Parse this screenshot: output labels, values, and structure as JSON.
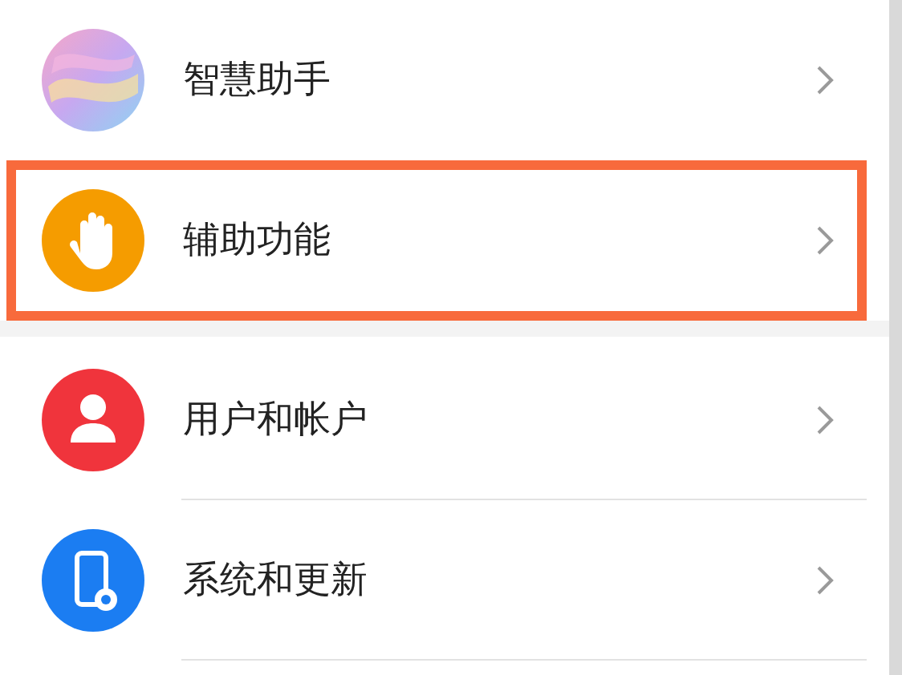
{
  "sections": [
    {
      "items": [
        {
          "label": "智慧助手",
          "kind": "orb",
          "highlighted": false
        },
        {
          "label": "辅助功能",
          "kind": "hand",
          "highlighted": true
        }
      ]
    },
    {
      "items": [
        {
          "label": "用户和帐户",
          "kind": "person",
          "highlighted": false
        },
        {
          "label": "系统和更新",
          "kind": "phone-gear",
          "highlighted": false
        }
      ]
    }
  ]
}
